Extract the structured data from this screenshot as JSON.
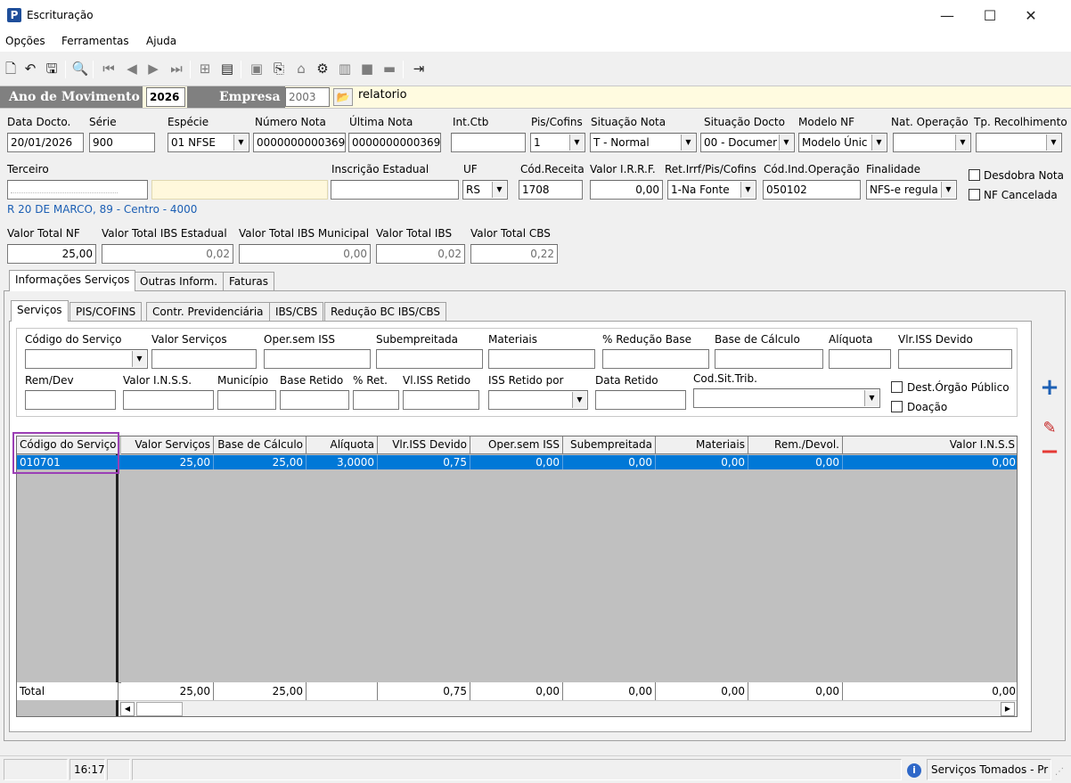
{
  "window": {
    "title": "Escrituração",
    "min": "—",
    "max": "☐",
    "close": "✕"
  },
  "menu": [
    "Opções",
    "Ferramentas",
    "Ajuda"
  ],
  "header": {
    "ano_label": "Ano de Movimento",
    "ano_value": "2026",
    "empresa_label": "Empresa",
    "empresa_value": "2003",
    "relatorio": "relatorio"
  },
  "form": {
    "data_docto": {
      "label": "Data Docto.",
      "value": "20/01/2026"
    },
    "serie": {
      "label": "Série",
      "value": "900"
    },
    "especie": {
      "label": "Espécie",
      "value": "01 NFSE"
    },
    "numero_nota": {
      "label": "Número Nota",
      "value": "0000000000369"
    },
    "ultima_nota": {
      "label": "Última Nota",
      "value": "0000000000369"
    },
    "int_ctb": {
      "label": "Int.Ctb",
      "value": ""
    },
    "pis_cofins": {
      "label": "Pis/Cofins",
      "value": "1"
    },
    "situacao_nota": {
      "label": "Situação Nota",
      "value": "T - Normal"
    },
    "situacao_docto": {
      "label": "Situação Docto",
      "value": "00 - Documer"
    },
    "modelo_nf": {
      "label": "Modelo NF",
      "value": "Modelo Únic"
    },
    "nat_operacao": {
      "label": "Nat. Operação",
      "value": ""
    },
    "tp_recolhimento": {
      "label": "Tp. Recolhimento",
      "value": ""
    },
    "terceiro": {
      "label": "Terceiro",
      "value": ""
    },
    "inscricao_estadual": {
      "label": "Inscrição Estadual",
      "value": ""
    },
    "uf": {
      "label": "UF",
      "value": "RS"
    },
    "cod_receita": {
      "label": "Cód.Receita",
      "value": "1708"
    },
    "valor_irrf": {
      "label": "Valor I.R.R.F.",
      "value": "0,00"
    },
    "ret_irrf": {
      "label": "Ret.Irrf/Pis/Cofins",
      "value": "1-Na Fonte"
    },
    "cod_ind_operacao": {
      "label": "Cód.Ind.Operação",
      "value": "050102"
    },
    "finalidade": {
      "label": "Finalidade",
      "value": "NFS-e regula"
    },
    "desdobra_nota": "Desdobra Nota",
    "nf_cancelada": "NF Cancelada",
    "address": "R 20 DE MARCO, 89 - Centro - 4000",
    "valor_total_nf": {
      "label": "Valor Total NF",
      "value": "25,00"
    },
    "valor_total_ibs_estadual": {
      "label": "Valor Total IBS Estadual",
      "value": "0,02"
    },
    "valor_total_ibs_municipal": {
      "label": "Valor Total IBS Municipal",
      "value": "0,00"
    },
    "valor_total_ibs": {
      "label": "Valor Total IBS",
      "value": "0,02"
    },
    "valor_total_cbs": {
      "label": "Valor Total CBS",
      "value": "0,22"
    }
  },
  "tabs_outer": [
    "Informações Serviços",
    "Outras Inform.",
    "Faturas"
  ],
  "tabs_inner": [
    "Serviços",
    "PIS/COFINS",
    "Contr. Previdenciária",
    "IBS/CBS",
    "Redução BC IBS/CBS"
  ],
  "servicos_form": {
    "codigo_servico": "Código do Serviço",
    "valor_servicos": "Valor Serviços",
    "oper_sem_iss": "Oper.sem ISS",
    "subempreitada": "Subempreitada",
    "materiais": "Materiais",
    "perc_reducao_base": "% Redução Base",
    "base_calculo": "Base de Cálculo",
    "aliquota": "Alíquota",
    "vlr_iss_devido": "Vlr.ISS Devido",
    "rem_dev": "Rem/Dev",
    "valor_inss": "Valor I.N.S.S.",
    "municipio": "Município",
    "base_retido": "Base Retido",
    "perc_ret": "% Ret.",
    "vl_iss_retido": "Vl.ISS Retido",
    "iss_retido_por": "ISS Retido por",
    "data_retido": "Data Retido",
    "cod_sit_trib": "Cod.Sit.Trib.",
    "dest_orgao_publico": "Dest.Órgão Público",
    "doacao": "Doação"
  },
  "grid": {
    "columns": [
      "Código do Serviço",
      "Valor Serviços",
      "Base de Cálculo",
      "Alíquota",
      "Vlr.ISS Devido",
      "Oper.sem ISS",
      "Subempreitada",
      "Materiais",
      "Rem./Devol.",
      "Valor I.N.S.S"
    ],
    "rows": [
      [
        "010701",
        "25,00",
        "25,00",
        "3,0000",
        "0,75",
        "0,00",
        "0,00",
        "0,00",
        "0,00",
        "0,00"
      ]
    ],
    "totals": [
      "Total",
      "25,00",
      "25,00",
      "",
      "0,75",
      "0,00",
      "0,00",
      "0,00",
      "0,00",
      "0,00"
    ]
  },
  "status": {
    "time": "16:17",
    "module": "Serviços Tomados - Pr"
  },
  "colors": {
    "selection": "#0078d7",
    "header_gray": "#808080",
    "header_bg": "#fffbe0",
    "link_blue": "#1c5fb4",
    "highlight_box": "#9b3fb5"
  }
}
